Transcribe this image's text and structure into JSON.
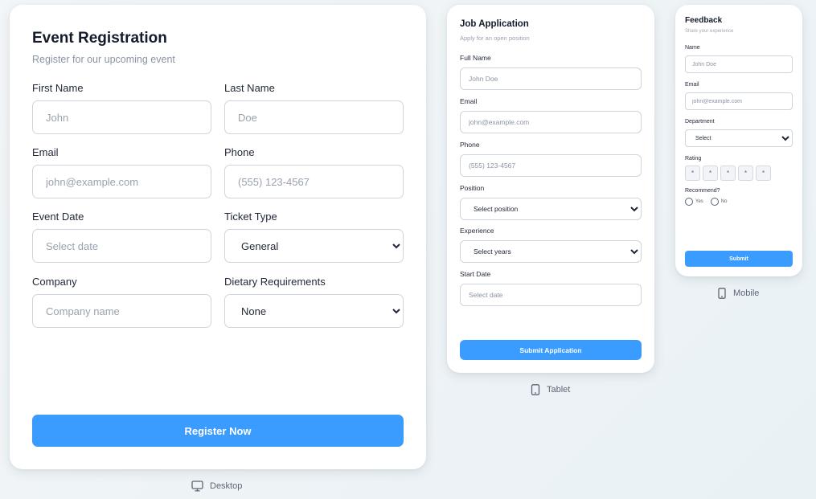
{
  "desktop": {
    "title": "Event Registration",
    "subtitle": "Register for our upcoming event",
    "fields": {
      "first_name": {
        "label": "First Name",
        "placeholder": "John"
      },
      "last_name": {
        "label": "Last Name",
        "placeholder": "Doe"
      },
      "email": {
        "label": "Email",
        "placeholder": "john@example.com"
      },
      "phone": {
        "label": "Phone",
        "placeholder": "(555) 123-4567"
      },
      "event_date": {
        "label": "Event Date",
        "placeholder": "Select date"
      },
      "ticket_type": {
        "label": "Ticket Type",
        "selected": "General"
      },
      "company": {
        "label": "Company",
        "placeholder": "Company name"
      },
      "dietary": {
        "label": "Dietary Requirements",
        "selected": "None"
      }
    },
    "submit_label": "Register Now",
    "device_label": "Desktop"
  },
  "tablet": {
    "title": "Job Application",
    "subtitle": "Apply for an open position",
    "fields": {
      "full_name": {
        "label": "Full Name",
        "placeholder": "John Doe"
      },
      "email": {
        "label": "Email",
        "placeholder": "john@example.com"
      },
      "phone": {
        "label": "Phone",
        "placeholder": "(555) 123-4567"
      },
      "position": {
        "label": "Position",
        "selected": "Select position"
      },
      "experience": {
        "label": "Experience",
        "selected": "Select years"
      },
      "start_date": {
        "label": "Start Date",
        "placeholder": "Select date"
      }
    },
    "submit_label": "Submit Application",
    "device_label": "Tablet"
  },
  "mobile": {
    "title": "Feedback",
    "subtitle": "Share your experience",
    "fields": {
      "name": {
        "label": "Name",
        "placeholder": "John Doe"
      },
      "email": {
        "label": "Email",
        "placeholder": "john@example.com"
      },
      "department": {
        "label": "Department",
        "selected": "Select"
      },
      "rating": {
        "label": "Rating",
        "stars": [
          "*",
          "*",
          "*",
          "*",
          "*"
        ]
      },
      "recommend": {
        "label": "Recommend?",
        "options": [
          "Yes",
          "No"
        ]
      }
    },
    "submit_label": "Submit",
    "device_label": "Mobile"
  },
  "colors": {
    "accent": "#3b9cff",
    "border": "#cfd5dd",
    "text": "#1f2637",
    "muted": "#8a93a3"
  },
  "icons": {
    "desktop": "monitor-icon",
    "tablet": "tablet-icon",
    "mobile": "phone-icon",
    "select": "chevron-down-icon"
  }
}
